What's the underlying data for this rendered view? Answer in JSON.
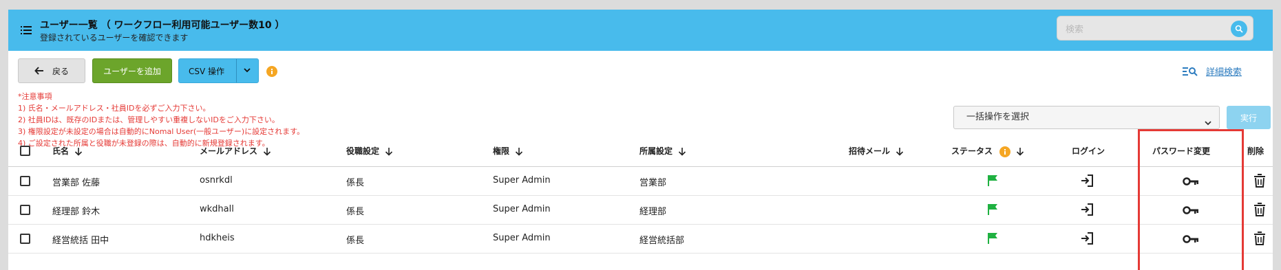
{
  "header": {
    "title": "ユーザー一覧 （ ワークフロー利用可能ユーザー数10 ）",
    "subtitle": "登録されているユーザーを確認できます",
    "search_placeholder": "検索",
    "menu_icon": "list-icon",
    "search_icon": "search-icon"
  },
  "toolbar": {
    "back_label": "戻る",
    "add_label": "ユーザーを追加",
    "csv_label": "CSV 操作",
    "advanced_search_label": "詳細検索"
  },
  "notes": [
    "*注意事項",
    "1) 氏名・メールアドレス・社員IDを必ずご入力下さい。",
    "2) 社員IDは、既存のIDまたは、管理しやすい重複しないIDをご入力下さい。",
    "3) 権限設定が未設定の場合は自動的にNomal User(一般ユーザー)に設定されます。",
    "4) ご設定された所属と役職が未登録の際は、自動的に新規登録されます。"
  ],
  "bulk": {
    "select_label": "一括操作を選択",
    "execute_label": "実行"
  },
  "table": {
    "columns": {
      "name": "氏名",
      "email": "メールアドレス",
      "position": "役職設定",
      "role": "権限",
      "department": "所属設定",
      "invite": "招待メール",
      "status": "ステータス",
      "login": "ログイン",
      "password": "パスワード変更",
      "delete": "削除"
    },
    "rows": [
      {
        "name": "営業部 佐藤",
        "email": "osnrkdl",
        "position": "係長",
        "role": "Super Admin",
        "department": "営業部"
      },
      {
        "name": "経理部 鈴木",
        "email": "wkdhall",
        "position": "係長",
        "role": "Super Admin",
        "department": "経理部"
      },
      {
        "name": "経営統括 田中",
        "email": "hdkheis",
        "position": "係長",
        "role": "Super Admin",
        "department": "経営統括部"
      }
    ]
  },
  "colors": {
    "header_bg": "#48bbec",
    "add_button": "#6ca52b",
    "status_flag": "#1fb141",
    "note_text": "#e53935",
    "highlight": "#e53935",
    "info": "#f5a623"
  }
}
